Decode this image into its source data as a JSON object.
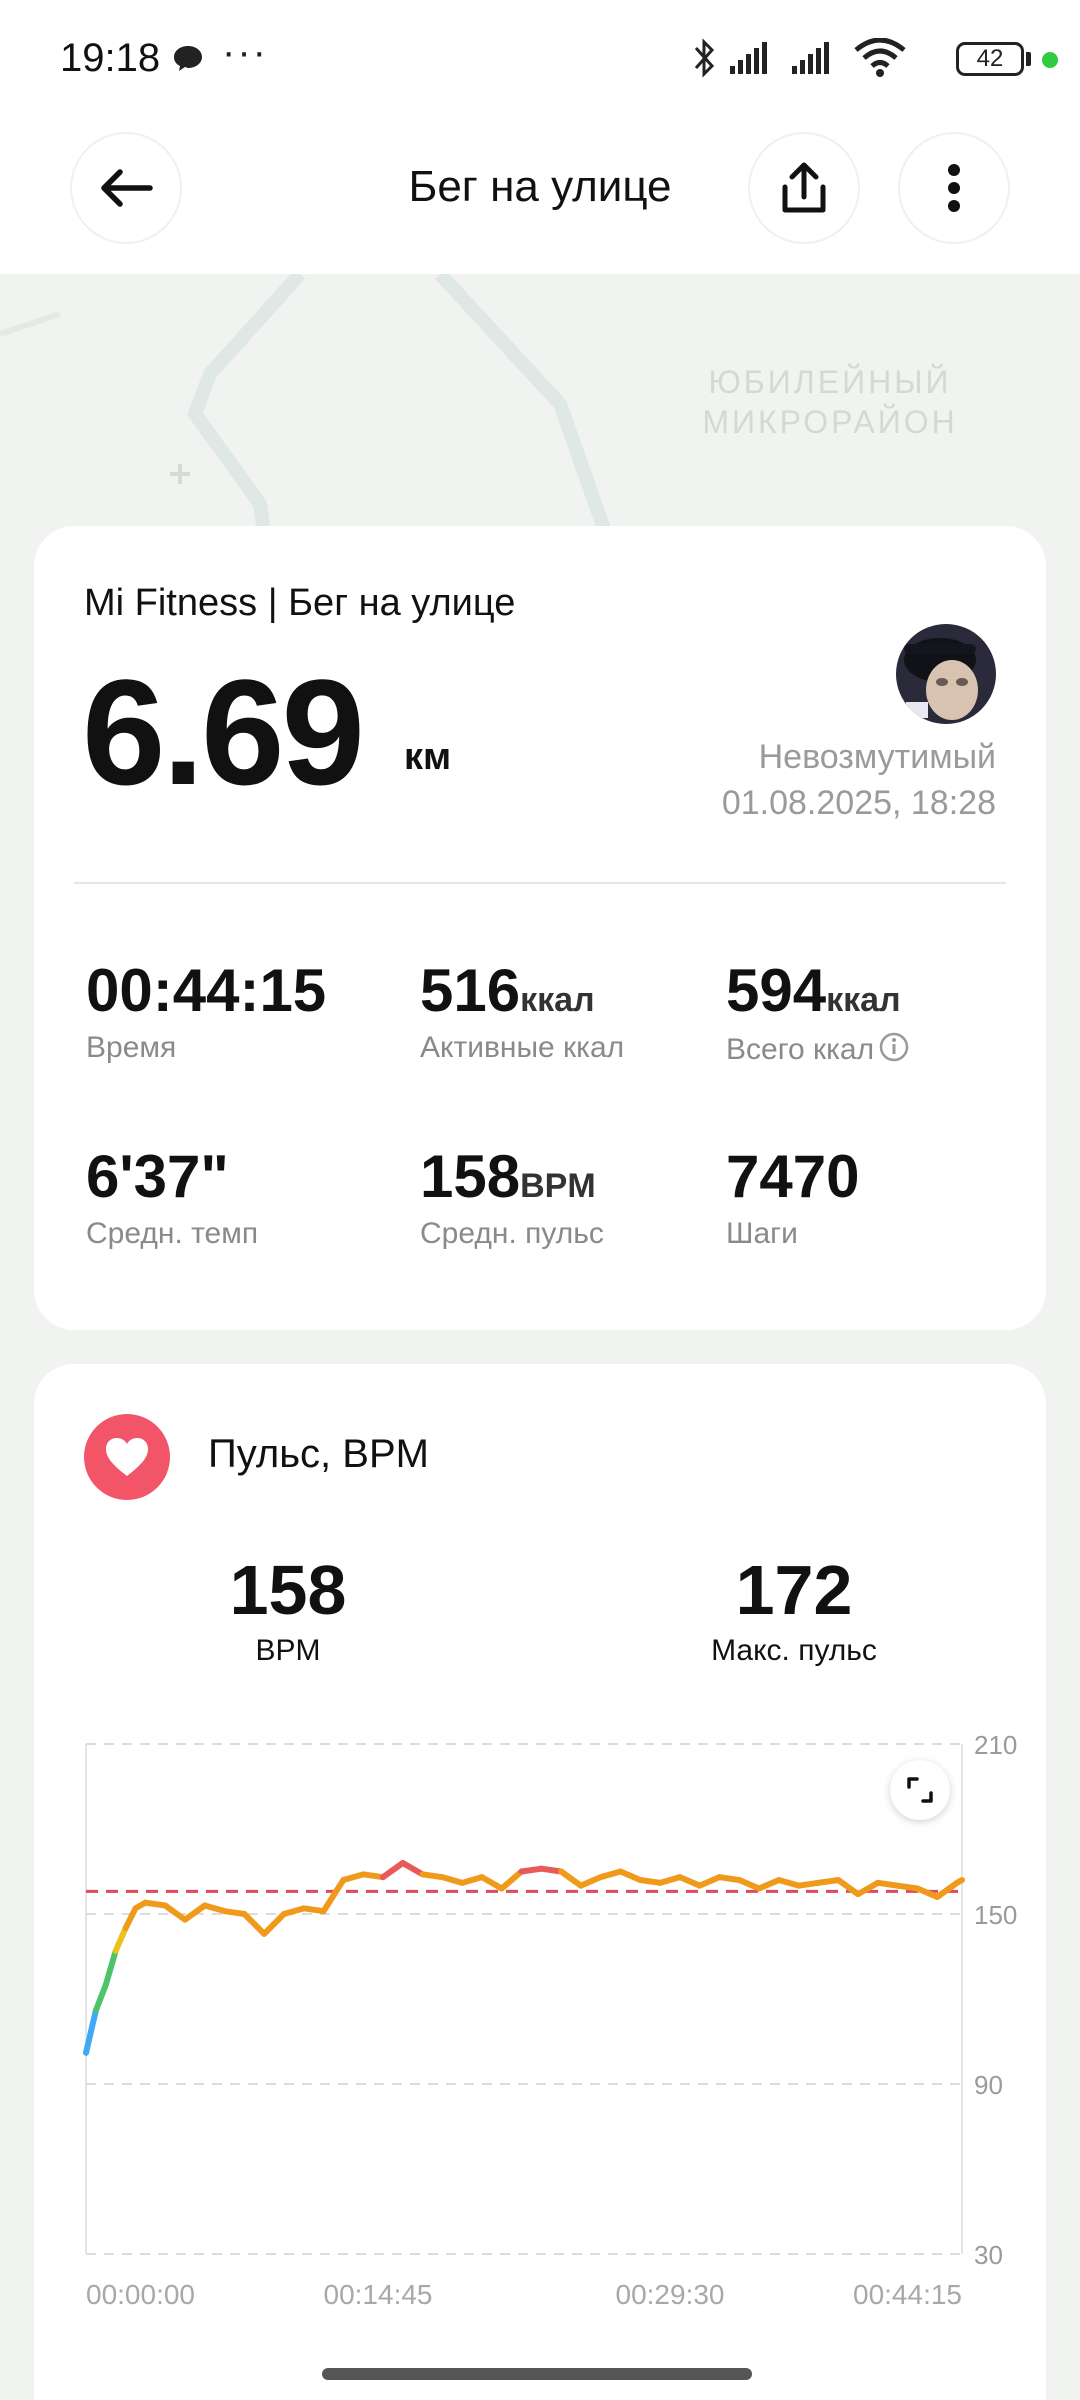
{
  "status_bar": {
    "time": "19:18",
    "dots": "···",
    "battery": "42"
  },
  "header": {
    "title": "Бег на улице"
  },
  "map": {
    "label": "ЮБИЛЕЙНЫЙ МИКРОРАЙОН"
  },
  "summary": {
    "source": "Mi Fitness | Бег на улице",
    "distance": "6.69",
    "distance_unit": "км",
    "user_name": "Невозмутимый",
    "date": "01.08.2025, 18:28",
    "stats": [
      {
        "value": "00:44:15",
        "unit": "",
        "label": "Время"
      },
      {
        "value": "516",
        "unit": "ккал",
        "label": "Активные ккал"
      },
      {
        "value": "594",
        "unit": "ккал",
        "label": "Всего ккал"
      },
      {
        "value": "6'37\"",
        "unit": "",
        "label": "Средн. темп"
      },
      {
        "value": "158",
        "unit": "BPM",
        "label": "Средн. пульс"
      },
      {
        "value": "7470",
        "unit": "",
        "label": "Шаги"
      }
    ]
  },
  "pulse": {
    "title": "Пульс, BPM",
    "avg_value": "158",
    "avg_label": "BPM",
    "max_value": "172",
    "max_label": "Макс. пульс"
  },
  "chart_data": {
    "type": "line",
    "y_ticks": [
      "210",
      "150",
      "90",
      "30"
    ],
    "x_ticks": [
      "00:00:00",
      "00:14:45",
      "00:29:30",
      "00:44:15"
    ],
    "ylim": [
      30,
      210
    ],
    "average_line": 158,
    "series": [
      {
        "x_minutes": [
          0,
          0.5,
          1,
          1.5,
          2,
          2.5,
          3,
          4,
          5,
          6,
          7,
          8,
          9,
          10,
          11,
          12,
          13,
          14,
          15,
          16,
          17,
          18,
          19,
          20,
          21,
          22,
          23,
          24,
          25,
          26,
          27,
          28,
          29,
          30,
          31,
          32,
          33,
          34,
          35,
          36,
          37,
          38,
          39,
          40,
          41,
          42,
          43,
          44,
          44.25
        ],
        "values": [
          101,
          116,
          125,
          137,
          145,
          152,
          154,
          153,
          148,
          153,
          151,
          150,
          143,
          150,
          152,
          151,
          162,
          164,
          163,
          168,
          164,
          163,
          161,
          163,
          159,
          165,
          166,
          165,
          160,
          163,
          165,
          162,
          161,
          163,
          160,
          163,
          162,
          159,
          162,
          160,
          161,
          162,
          157,
          161,
          160,
          159,
          156,
          161,
          162
        ]
      }
    ]
  },
  "colors": {
    "accent_red": "#f25468",
    "line_orange": "#f09a1c",
    "line_peak": "#e85a5a",
    "line_low": "#3fa9f5"
  }
}
